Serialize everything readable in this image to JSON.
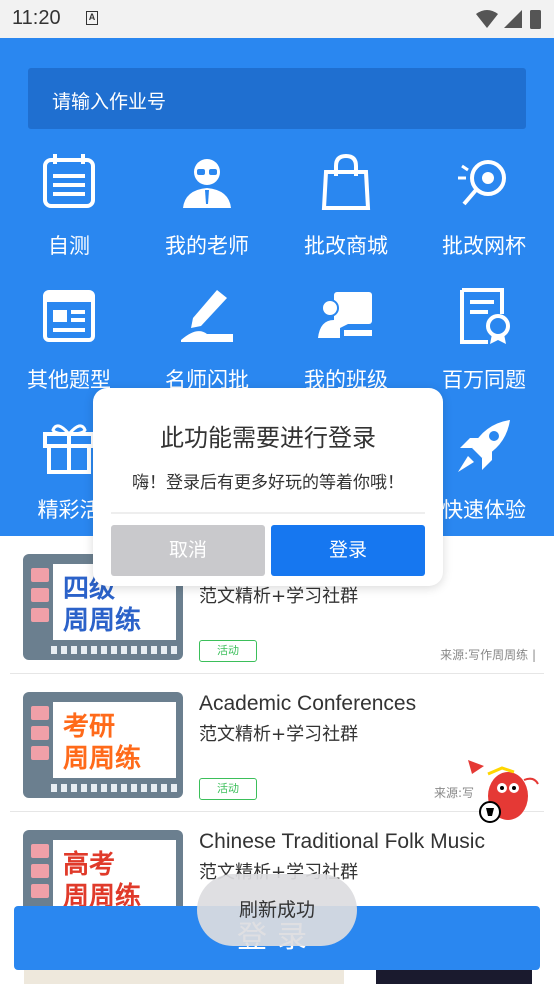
{
  "status_bar": {
    "time": "11:20",
    "sim_icon": "sim-card-icon",
    "icons": [
      "wifi-icon",
      "signal-icon",
      "battery-icon"
    ]
  },
  "search": {
    "placeholder": "请输入作业号"
  },
  "grid": [
    {
      "label": "自测",
      "icon": "notebook-icon"
    },
    {
      "label": "我的老师",
      "icon": "teacher-icon"
    },
    {
      "label": "批改商城",
      "icon": "shopping-bag-icon"
    },
    {
      "label": "批改网杯",
      "icon": "trophy-icon"
    },
    {
      "label": "其他题型",
      "icon": "browser-window-icon"
    },
    {
      "label": "名师闪批",
      "icon": "pencil-write-icon"
    },
    {
      "label": "我的班级",
      "icon": "classroom-icon"
    },
    {
      "label": "百万同题",
      "icon": "certificate-icon"
    },
    {
      "label": "精彩活",
      "icon": "gift-icon"
    },
    {
      "label": "快速体验",
      "icon": "rocket-icon"
    }
  ],
  "cards": [
    {
      "thumb_line1": "四级",
      "thumb_line2": "周周练",
      "title": "",
      "subtitle": "范文精析+学习社群",
      "tag": "活动",
      "source": "来源:写作周周练 |"
    },
    {
      "thumb_line1": "考研",
      "thumb_line2": "周周练",
      "title": "Academic Conferences",
      "subtitle": "范文精析+学习社群",
      "tag": "活动",
      "source": "来源:写"
    },
    {
      "thumb_line1": "高考",
      "thumb_line2": "周周练",
      "title": "Chinese Traditional Folk Music",
      "subtitle": "范文精析+学习社群",
      "tag": "",
      "source": ""
    }
  ],
  "login_bar": {
    "label": "登录"
  },
  "toast": {
    "text": "刷新成功"
  },
  "dialog": {
    "title": "此功能需要进行登录",
    "message": "嗨！登录后有更多好玩的等着你哦！",
    "cancel_label": "取消",
    "login_label": "登录"
  },
  "colors": {
    "primary": "#2a87f0",
    "dialog_login": "#1677f0",
    "cancel": "#c9c9cc",
    "tag_green": "#3bbf5a"
  }
}
